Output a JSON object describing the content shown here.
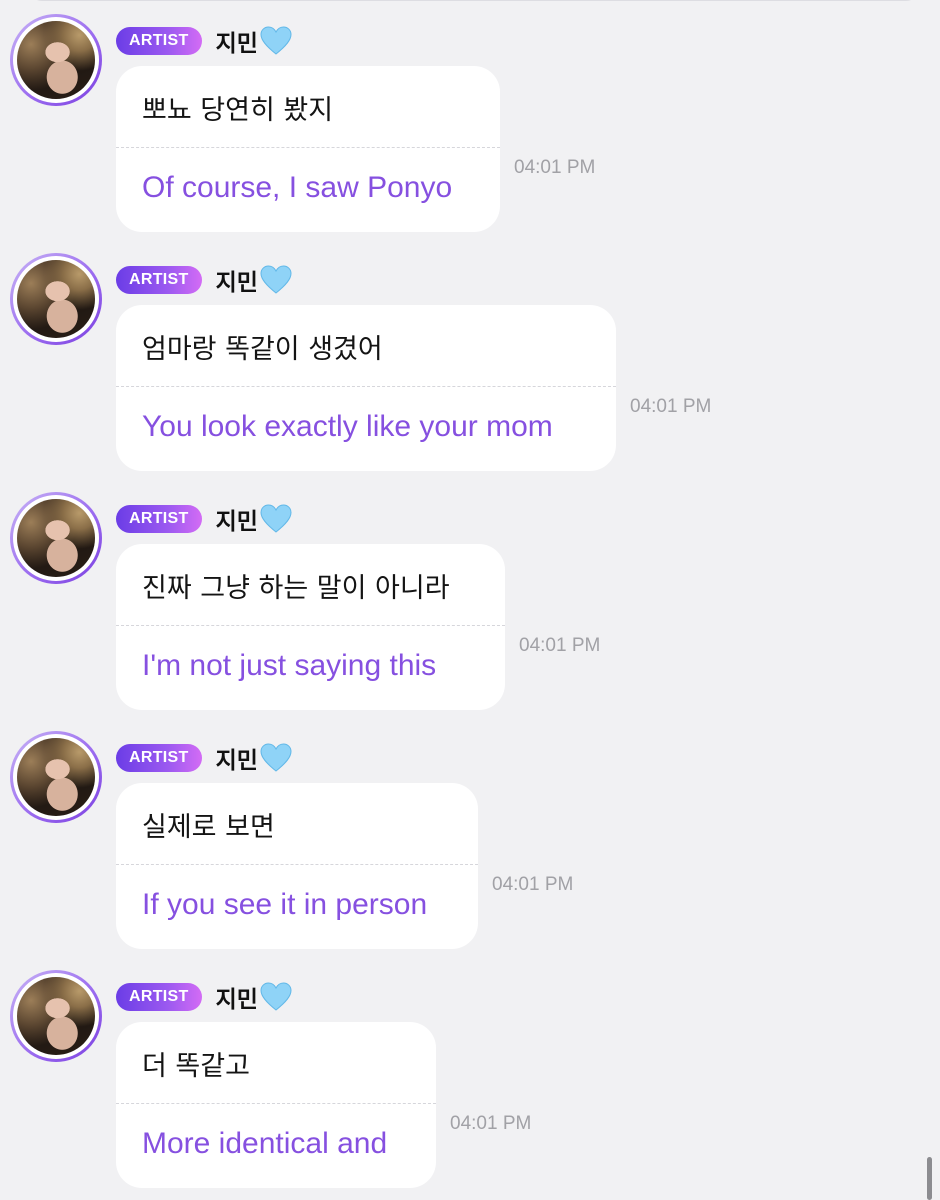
{
  "sender": {
    "badge": "ARTIST",
    "name": "지민",
    "name_emoji": "light-blue-heart"
  },
  "messages": [
    {
      "korean": "뽀뇨 당연히 봤지",
      "english": "Of course, I saw Ponyo",
      "time": "04:01 PM"
    },
    {
      "korean": "엄마랑 똑같이 생겼어",
      "english": "You look exactly like your mom",
      "time": "04:01 PM"
    },
    {
      "korean": "진짜 그냥 하는 말이 아니라",
      "english": "I'm not just saying this",
      "time": "04:01 PM"
    },
    {
      "korean": "실제로 보면",
      "english": "If you see it in person",
      "time": "04:01 PM"
    },
    {
      "korean": "더 똑같고",
      "english": "More identical and",
      "time": "04:01 PM"
    }
  ],
  "colors": {
    "background": "#f1f1f3",
    "bubble": "#ffffff",
    "translation_text": "#8650e0",
    "badge_start": "#6b3de6",
    "badge_end": "#d36cf5",
    "timestamp": "#a1a1a6",
    "heart": "#8fd3f7"
  }
}
